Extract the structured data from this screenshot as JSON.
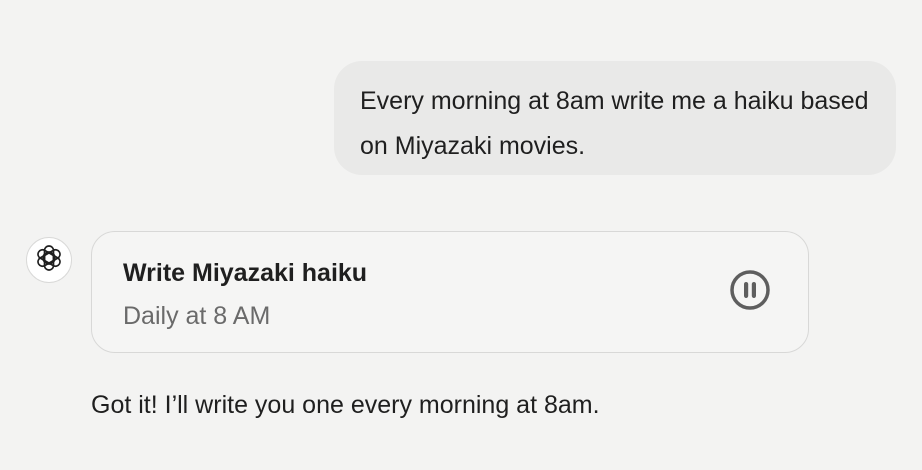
{
  "conversation": {
    "user_message": "Every morning at 8am write me a haiku based on Miyazaki movies.",
    "assistant_icon": "openai-logo-icon",
    "task": {
      "title": "Write Miyazaki haiku",
      "schedule": "Daily at 8 AM",
      "action_icon": "pause-circle-icon"
    },
    "assistant_reply": "Got it! I’ll write you one every morning at 8am."
  },
  "colors": {
    "background": "#f3f3f2",
    "user_bubble": "#e9e9e8",
    "card_border": "#d8d8d7",
    "text_primary": "#1f1f1f",
    "text_secondary": "#6a6a6a",
    "icon": "#5e5e5e"
  }
}
